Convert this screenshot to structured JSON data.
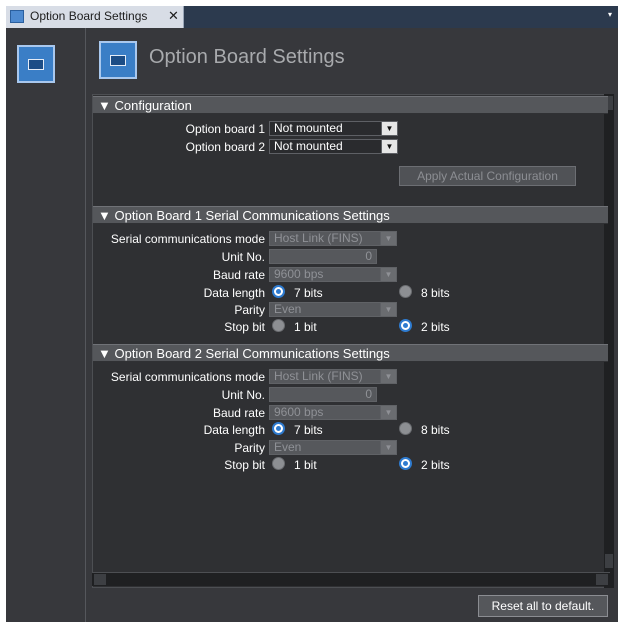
{
  "tab": {
    "title": "Option Board Settings",
    "close": "✕"
  },
  "page": {
    "title": "Option Board Settings"
  },
  "configuration": {
    "header": "▼ Configuration",
    "board1": {
      "label": "Option board 1",
      "value": "Not mounted"
    },
    "board2": {
      "label": "Option board 2",
      "value": "Not mounted"
    },
    "apply_button": "Apply Actual Configuration"
  },
  "serial1": {
    "header": "▼ Option Board 1 Serial Communications Settings",
    "mode": {
      "label": "Serial communications mode",
      "value": "Host Link (FINS)"
    },
    "unit_no": {
      "label": "Unit No.",
      "value": "0"
    },
    "baud": {
      "label": "Baud rate",
      "value": "9600 bps"
    },
    "data_length": {
      "label": "Data length",
      "options": [
        "7 bits",
        "8 bits"
      ],
      "selected": "7 bits"
    },
    "parity": {
      "label": "Parity",
      "value": "Even"
    },
    "stop_bit": {
      "label": "Stop bit",
      "options": [
        "1 bit",
        "2 bits"
      ],
      "selected": "2 bits"
    }
  },
  "serial2": {
    "header": "▼ Option Board 2 Serial Communications Settings",
    "mode": {
      "label": "Serial communications mode",
      "value": "Host Link (FINS)"
    },
    "unit_no": {
      "label": "Unit No.",
      "value": "0"
    },
    "baud": {
      "label": "Baud rate",
      "value": "9600 bps"
    },
    "data_length": {
      "label": "Data length",
      "options": [
        "7 bits",
        "8 bits"
      ],
      "selected": "7 bits"
    },
    "parity": {
      "label": "Parity",
      "value": "Even"
    },
    "stop_bit": {
      "label": "Stop bit",
      "options": [
        "1 bit",
        "2 bits"
      ],
      "selected": "2 bits"
    }
  },
  "footer": {
    "reset_button": "Reset all to default."
  },
  "icons": {
    "tab": "option-board-icon",
    "sidebar": "option-board-icon",
    "header": "option-board-icon",
    "dropdown": "dropdown-arrow-icon"
  },
  "colors": {
    "accent": "#2e7bd0",
    "background": "#37383c",
    "section_header": "#55575b"
  }
}
